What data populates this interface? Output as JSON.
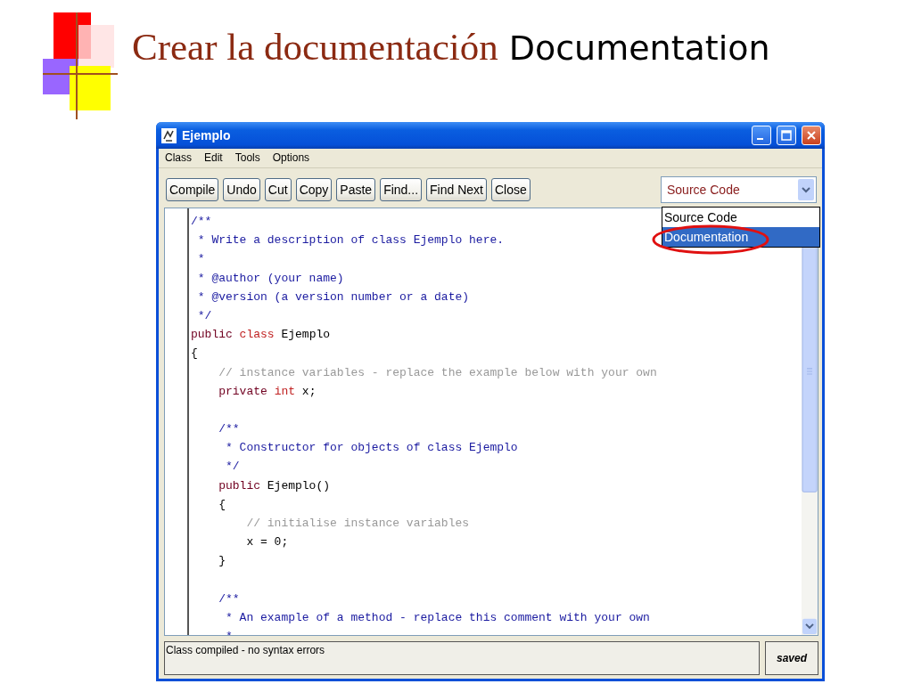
{
  "slide": {
    "title": "Crear la documentación",
    "title_suffix": "Documentation"
  },
  "window": {
    "title": "Ejemplo"
  },
  "menu": [
    "Class",
    "Edit",
    "Tools",
    "Options"
  ],
  "toolbar": [
    "Compile",
    "Undo",
    "Cut",
    "Copy",
    "Paste",
    "Find...",
    "Find Next",
    "Close"
  ],
  "view_select": {
    "value": "Source Code",
    "options": [
      {
        "label": "Source Code",
        "highlighted": false
      },
      {
        "label": "Documentation",
        "highlighted": true
      }
    ]
  },
  "code": [
    {
      "tokens": [
        {
          "kind": "doc",
          "text": "/**"
        }
      ]
    },
    {
      "tokens": [
        {
          "kind": "doc",
          "text": " * Write a description of class Ejemplo here."
        }
      ]
    },
    {
      "tokens": [
        {
          "kind": "doc",
          "text": " *"
        }
      ]
    },
    {
      "tokens": [
        {
          "kind": "doc",
          "text": " * @author (your name)"
        }
      ]
    },
    {
      "tokens": [
        {
          "kind": "doc",
          "text": " * @version (a version number or a date)"
        }
      ]
    },
    {
      "tokens": [
        {
          "kind": "doc",
          "text": " */"
        }
      ]
    },
    {
      "tokens": [
        {
          "kind": "modifier",
          "text": "public"
        },
        {
          "kind": "keyword",
          "text": " class"
        },
        {
          "kind": "plain",
          "text": " Ejemplo"
        }
      ]
    },
    {
      "tokens": [
        {
          "kind": "plain",
          "text": "{"
        }
      ]
    },
    {
      "tokens": [
        {
          "kind": "comment",
          "text": "    // instance variables - replace the example below with your own"
        }
      ]
    },
    {
      "tokens": [
        {
          "kind": "modifier",
          "text": "    private"
        },
        {
          "kind": "keyword",
          "text": " int"
        },
        {
          "kind": "plain",
          "text": " x;"
        }
      ]
    },
    {
      "kind": "blank"
    },
    {
      "tokens": [
        {
          "kind": "doc",
          "text": "    /**"
        }
      ]
    },
    {
      "tokens": [
        {
          "kind": "doc",
          "text": "     * Constructor for objects of class Ejemplo"
        }
      ]
    },
    {
      "tokens": [
        {
          "kind": "doc",
          "text": "     */"
        }
      ]
    },
    {
      "tokens": [
        {
          "kind": "modifier",
          "text": "    public"
        },
        {
          "kind": "plain",
          "text": " Ejemplo()"
        }
      ]
    },
    {
      "tokens": [
        {
          "kind": "plain",
          "text": "    {"
        }
      ]
    },
    {
      "tokens": [
        {
          "kind": "comment",
          "text": "        // initialise instance variables"
        }
      ]
    },
    {
      "tokens": [
        {
          "kind": "plain",
          "text": "        x = 0;"
        }
      ]
    },
    {
      "tokens": [
        {
          "kind": "plain",
          "text": "    }"
        }
      ]
    },
    {
      "kind": "blank"
    },
    {
      "tokens": [
        {
          "kind": "doc",
          "text": "    /**"
        }
      ]
    },
    {
      "tokens": [
        {
          "kind": "doc",
          "text": "     * An example of a method - replace this comment with your own"
        }
      ]
    },
    {
      "tokens": [
        {
          "kind": "doc",
          "text": "     *"
        }
      ]
    }
  ],
  "status_bar": {
    "message": "Class compiled - no syntax errors",
    "state": "saved"
  }
}
